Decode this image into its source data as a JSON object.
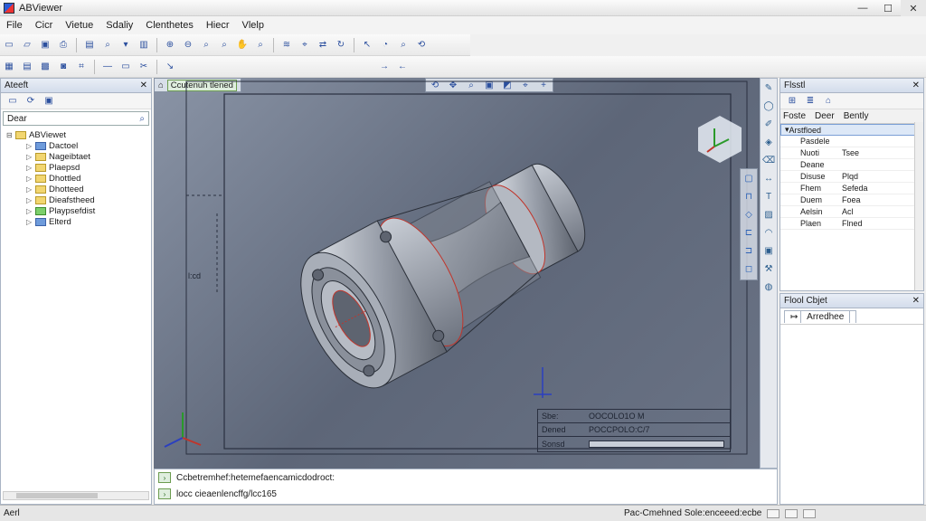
{
  "window": {
    "title": "ABViewer",
    "minimize": "—",
    "maximize": "☐",
    "close": "✕"
  },
  "menu": [
    "File",
    "Cicr",
    "Vietue",
    "Sdaliy",
    "Clenthetes",
    "Hiecr",
    "Vlelp"
  ],
  "left_panel": {
    "title": "Ateeft",
    "close": "✕",
    "search_placeholder": "Dear",
    "tree": [
      {
        "label": "ABViewet",
        "color": "yellow",
        "expanded": true
      },
      {
        "label": "Dactoel",
        "color": "blue"
      },
      {
        "label": "Nageibtaet",
        "color": "yellow"
      },
      {
        "label": "Plaepsd",
        "color": "yellow"
      },
      {
        "label": "Dhottled",
        "color": "yellow"
      },
      {
        "label": "Dhotteed",
        "color": "yellow"
      },
      {
        "label": "Dieafstheed",
        "color": "yellow"
      },
      {
        "label": "Playpsefdist",
        "color": "green"
      },
      {
        "label": "Elterd",
        "color": "blue"
      }
    ]
  },
  "viewport": {
    "tag": "Ccutenuh tlened",
    "leader_label": "l:cd",
    "titleblock": [
      {
        "k": "Sbe:",
        "v": "OOCOLO1O M"
      },
      {
        "k": "Dened",
        "v": "POCCPOLO:C/7"
      },
      {
        "k": "Sonsd",
        "v": ""
      }
    ]
  },
  "right_panel": {
    "title": "Flsstl",
    "close": "✕",
    "columns": [
      "Foste",
      "Deer",
      "Bently"
    ],
    "selected": "Arstfloed",
    "rows": [
      {
        "name": "Pasdele",
        "value": ""
      },
      {
        "name": "Nuoti",
        "value": "Tsee"
      },
      {
        "name": "Deane",
        "value": ""
      },
      {
        "name": "Disuse",
        "value": "Plqd"
      },
      {
        "name": "Fhem",
        "value": "Sefeda"
      },
      {
        "name": "Duem",
        "value": "Foea"
      },
      {
        "name": "Aelsin",
        "value": "Acl"
      },
      {
        "name": "Plaen",
        "value": "Flned"
      }
    ]
  },
  "right_panel2": {
    "title": "Flool Cbjet",
    "close": "✕",
    "tab": "Arredhee"
  },
  "command": {
    "line1": "Ccbetremhef:hetemefaencamicdodroct:",
    "line2": "locc cieaenlencffg/lcc165"
  },
  "status": {
    "left": "Aerl",
    "right": "Pac-Cmehned  Sole:enceeed:ecbe"
  },
  "colors": {
    "accent": "#2b4f9e",
    "part": "#9aa0ab",
    "edge": "#c0352b"
  }
}
